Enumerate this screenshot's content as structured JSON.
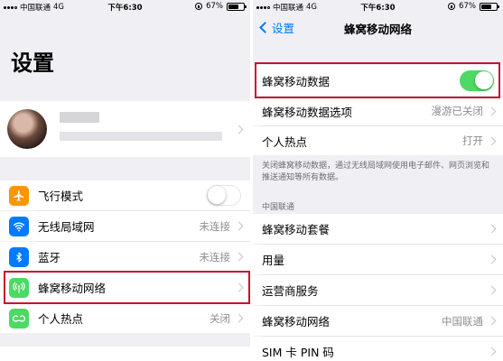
{
  "colors": {
    "ios_blue": "#007aff",
    "toggle_on": "#4cd964",
    "highlight_red": "#c8102e",
    "airplane_orange": "#ff9500",
    "wifi_blue": "#007aff",
    "bluetooth_blue": "#007aff",
    "cellular_green": "#4cd964",
    "hotspot_green": "#4cd964"
  },
  "left": {
    "status": {
      "carrier": "中国联通",
      "network": "4G",
      "time": "下午6:30",
      "battery": "67%",
      "battery_level": 0.67
    },
    "title": "设置",
    "rows": [
      {
        "label": "飞行模式",
        "icon": "airplane-icon",
        "toggle": "off"
      },
      {
        "label": "无线局域网",
        "icon": "wifi-icon",
        "value": "未连接"
      },
      {
        "label": "蓝牙",
        "icon": "bluetooth-icon",
        "value": "未连接"
      },
      {
        "label": "蜂窝移动网络",
        "icon": "cellular-icon",
        "value": ""
      },
      {
        "label": "个人热点",
        "icon": "hotspot-icon",
        "value": "关闭"
      }
    ]
  },
  "right": {
    "status": {
      "carrier": "中国联通",
      "network": "4G",
      "time": "下午6:30",
      "battery": "67%",
      "battery_level": 0.67
    },
    "nav": {
      "back_label": "设置",
      "title": "蜂窝移动网络"
    },
    "top_rows": [
      {
        "label": "蜂窝移动数据",
        "toggle": "on"
      },
      {
        "label": "蜂窝移动数据选项",
        "value": "漫游已关闭"
      },
      {
        "label": "个人热点",
        "value": "打开"
      }
    ],
    "footnote": "关闭蜂窝移动数据，通过无线局域网使用电子邮件、网页浏览和推送通知等所有数据。",
    "section_header": "中国联通",
    "carrier_rows": [
      {
        "label": "蜂窝移动套餐",
        "value": ""
      },
      {
        "label": "用量",
        "value": ""
      },
      {
        "label": "运营商服务",
        "value": ""
      },
      {
        "label": "蜂窝移动网络",
        "value": "中国联通"
      },
      {
        "label": "SIM 卡 PIN 码",
        "value": ""
      }
    ]
  }
}
